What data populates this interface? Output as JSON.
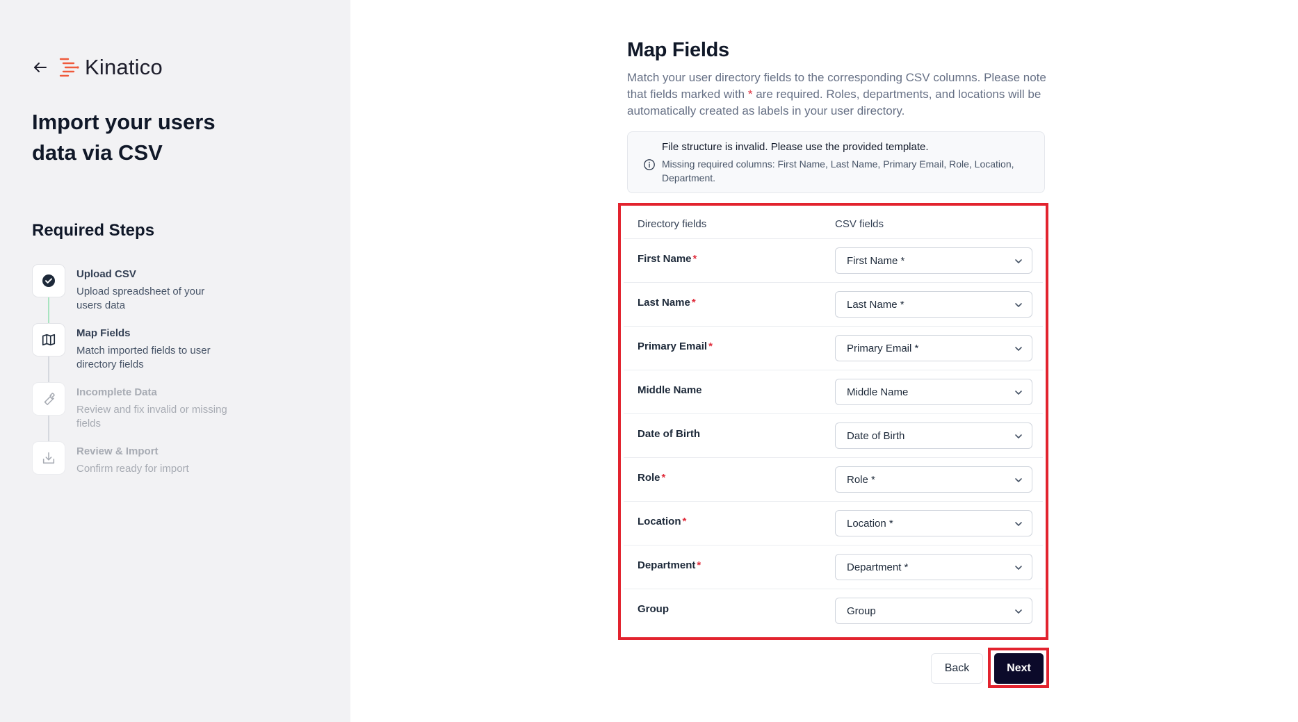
{
  "brand": {
    "name": "Kinatico"
  },
  "sidebar": {
    "heading": "Import your users data via CSV",
    "steps_heading": "Required Steps",
    "steps": [
      {
        "title": "Upload CSV",
        "desc": "Upload spreadsheet of your users data",
        "icon": "check-circle-icon",
        "state": "completed"
      },
      {
        "title": "Map Fields",
        "desc": "Match imported fields to user directory fields",
        "icon": "map-icon",
        "state": "current"
      },
      {
        "title": "Incomplete Data",
        "desc": "Review and fix invalid or missing fields",
        "icon": "wrench-icon",
        "state": "upcoming"
      },
      {
        "title": "Review & Import",
        "desc": "Confirm ready for import",
        "icon": "download-icon",
        "state": "upcoming"
      }
    ]
  },
  "main": {
    "title": "Map Fields",
    "desc_part1": "Match your user directory fields to the corresponding CSV columns. Please note that fields marked with ",
    "desc_marker": "*",
    "desc_part2": " are required. Roles, departments, and locations will be automatically created as labels in your user directory.",
    "alert": {
      "title": "File structure is invalid. Please use the provided template.",
      "message": "Missing required columns: First Name, Last Name, Primary Email, Role, Location, Department."
    },
    "table": {
      "col_directory": "Directory fields",
      "col_csv": "CSV fields",
      "rows": [
        {
          "label": "First Name",
          "required_mark": "*",
          "value": "First Name *"
        },
        {
          "label": "Last Name",
          "required_mark": "*",
          "value": "Last Name *"
        },
        {
          "label": "Primary Email",
          "required_mark": "*",
          "value": "Primary Email *"
        },
        {
          "label": "Middle Name",
          "required_mark": "",
          "value": "Middle Name"
        },
        {
          "label": "Date of Birth",
          "required_mark": "",
          "value": "Date of Birth"
        },
        {
          "label": "Role",
          "required_mark": "*",
          "value": "Role *"
        },
        {
          "label": "Location",
          "required_mark": "*",
          "value": "Location *"
        },
        {
          "label": "Department",
          "required_mark": "*",
          "value": "Department *"
        },
        {
          "label": "Group",
          "required_mark": "",
          "value": "Group"
        }
      ]
    },
    "buttons": {
      "back": "Back",
      "next": "Next"
    }
  },
  "colors": {
    "accent_dark": "#0b0a2a",
    "required": "#e02d3c",
    "highlight": "#e2232e",
    "brand_orange": "#ef5a3c",
    "sidebar_bg": "#f2f2f4"
  }
}
